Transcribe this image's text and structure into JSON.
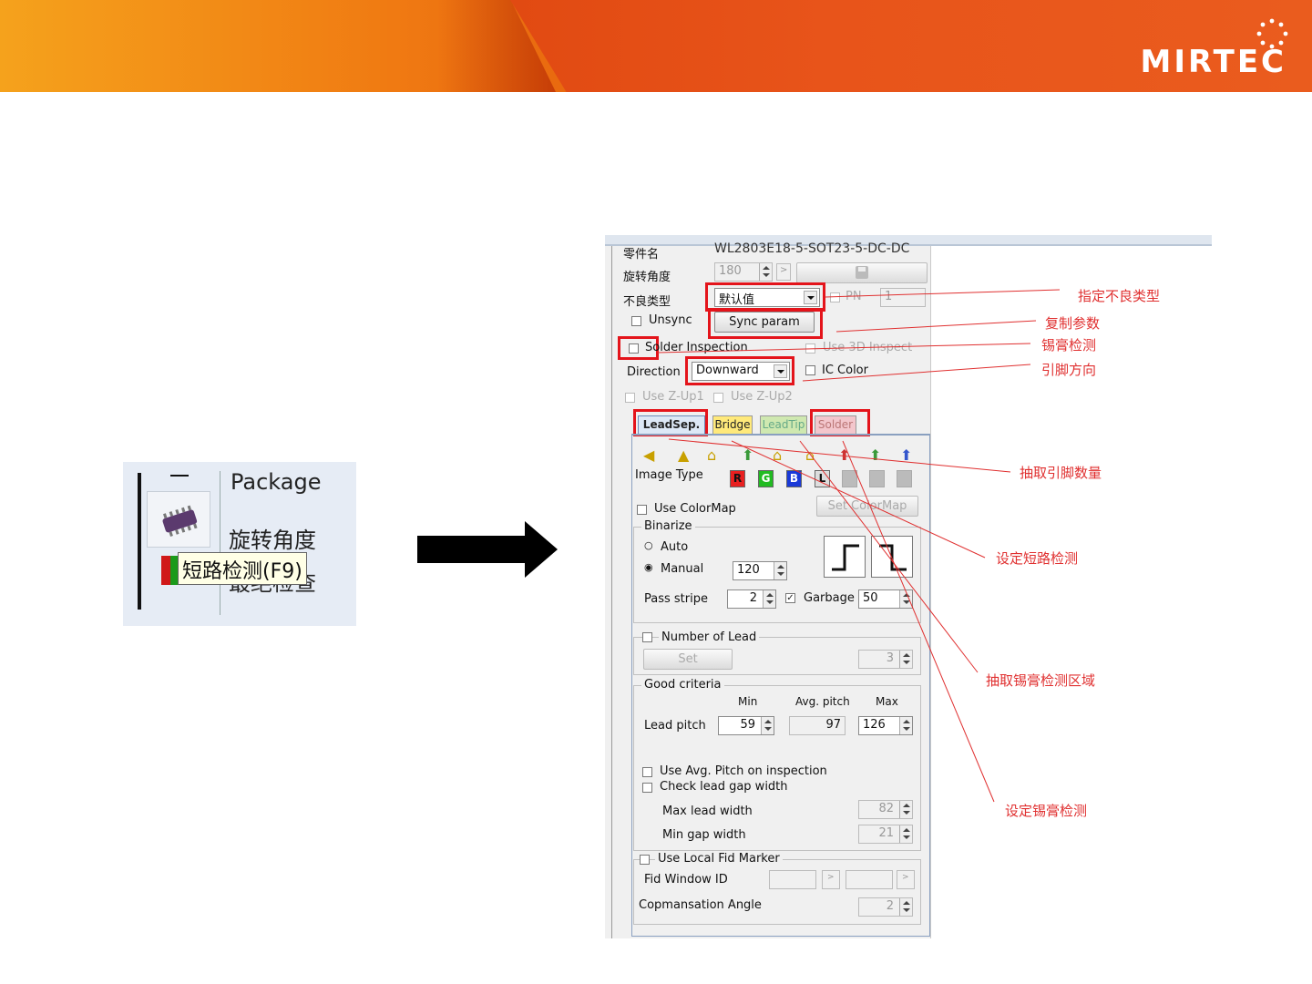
{
  "brand": {
    "logo": "MIRTEC"
  },
  "inset": {
    "dash": "一",
    "package_label": "Package",
    "rotation_label": "旋转角度",
    "tooltip": "短路检测(F9)",
    "partial_label": "最绝检查"
  },
  "panel": {
    "part_name_label": "零件名",
    "part_name_value": "WL2803E18-5-SOT23-5-DC-DC",
    "rotation_label": "旋转角度",
    "rotation_value": "180",
    "defect_type_label": "不良类型",
    "defect_type_value": "默认值",
    "pn_label": "PN",
    "pn_value": "1",
    "unsync_label": "Unsync",
    "sync_param_label": "Sync param",
    "solder_inspection_label": "Solder Inspection",
    "use_3d_inspect_label": "Use 3D Inspect",
    "direction_label": "Direction",
    "direction_value": "Downward",
    "ic_color_label": "IC Color",
    "use_zup1_label": "Use Z-Up1",
    "use_zup2_label": "Use Z-Up2",
    "tabs": [
      "LeadSep.",
      "Bridge",
      "LeadTip",
      "Solder"
    ],
    "image_type_label": "Image Type",
    "color_buttons": [
      "R",
      "G",
      "B",
      "L"
    ],
    "use_colormap_label": "Use ColorMap",
    "set_colormap_label": "Set ColorMap",
    "binarize_title": "Binarize",
    "auto_label": "Auto",
    "manual_label": "Manual",
    "manual_value": "120",
    "pass_stripe_label": "Pass stripe",
    "pass_stripe_value": "2",
    "garbage_label": "Garbage",
    "garbage_value": "50",
    "number_of_lead_label": "Number of Lead",
    "set_label": "Set",
    "lead_count_value": "3",
    "good_criteria_title": "Good criteria",
    "col_min": "Min",
    "col_avg": "Avg. pitch",
    "col_max": "Max",
    "lead_pitch_label": "Lead pitch",
    "lead_pitch_min": "59",
    "lead_pitch_avg": "97",
    "lead_pitch_max": "126",
    "use_avg_pitch_label": "Use Avg. Pitch on inspection",
    "check_gap_label": "Check lead  gap width",
    "max_lead_width_label": "Max lead width",
    "max_lead_width_value": "82",
    "min_gap_width_label": "Min gap width",
    "min_gap_width_value": "21",
    "use_local_fid_label": "Use Local Fid Marker",
    "fid_window_label": "Fid Window ID",
    "comp_angle_label": "Copmansation Angle",
    "comp_angle_value": "2"
  },
  "annotations": {
    "defect_type": "指定不良类型",
    "copy_param": "复制参数",
    "solder_check": "锡膏检测",
    "lead_direction": "引脚方向",
    "extract_lead_count": "抽取引脚数量",
    "set_short_check": "设定短路检测",
    "extract_solder_area": "抽取锡膏检测区域",
    "set_solder_check": "设定锡膏检测"
  },
  "colors": {
    "banner_orange": "#f39a18",
    "banner_red": "#c42a06",
    "annotation_red": "#e4141b",
    "arrow": "#000000"
  }
}
